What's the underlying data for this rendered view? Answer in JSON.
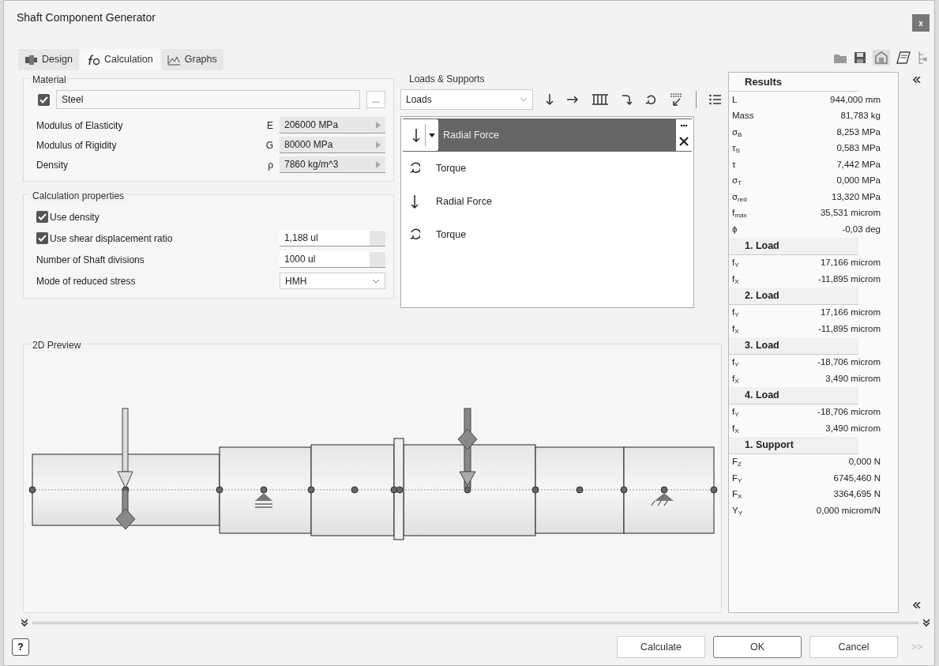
{
  "window": {
    "title": "Shaft Component Generator",
    "close": "x"
  },
  "tabs": [
    {
      "label": "Design",
      "selected": false,
      "kind": "design"
    },
    {
      "label": "Calculation",
      "selected": true,
      "kind": "calc"
    },
    {
      "label": "Graphs",
      "selected": false,
      "kind": "graph"
    }
  ],
  "material": {
    "title": "Material",
    "checked": true,
    "name": "Steel",
    "browse": "...",
    "properties": [
      {
        "label": "Modulus of Elasticity",
        "symbol": "E",
        "value": "206000 MPa"
      },
      {
        "label": "Modulus of Rigidity",
        "symbol": "G",
        "value": "80000 MPa"
      },
      {
        "label": "Density",
        "symbol": "ρ",
        "value": "7860 kg/m^3"
      }
    ]
  },
  "calculation_properties": {
    "title": "Calculation properties",
    "rows": [
      {
        "kind": "check",
        "label": "Use density",
        "checked": true
      },
      {
        "kind": "check-field",
        "label": "Use shear displacement ratio",
        "checked": true,
        "value": "1,188 ul"
      },
      {
        "kind": "field",
        "label": "Number of Shaft divisions",
        "value": "1000 ul"
      },
      {
        "kind": "select",
        "label": "Mode of reduced stress",
        "value": "HMH"
      }
    ]
  },
  "loads": {
    "title": "Loads & Supports",
    "filter": "Loads",
    "items": [
      {
        "kind": "radial",
        "label": "Radial Force",
        "selected": true
      },
      {
        "kind": "torque",
        "label": "Torque",
        "selected": false
      },
      {
        "kind": "radial",
        "label": "Radial Force",
        "selected": false
      },
      {
        "kind": "torque",
        "label": "Torque",
        "selected": false
      }
    ]
  },
  "preview": {
    "title": "2D Preview"
  },
  "results": {
    "title": "Results",
    "rows": [
      {
        "label": "L",
        "value": "944,000 mm"
      },
      {
        "label": "Mass",
        "value": "81,783 kg"
      },
      {
        "label": "σ$_{B}$",
        "value": "8,253 MPa"
      },
      {
        "label": "τ$_{S}$",
        "value": "0,583 MPa"
      },
      {
        "label": "τ",
        "value": "7,442 MPa"
      },
      {
        "label": "σ$_{T}$",
        "value": "0,000 MPa"
      },
      {
        "label": "σ$_{red}$",
        "value": "13,320 MPa"
      },
      {
        "label": "f$_{max}$",
        "value": "35,531 microm"
      },
      {
        "label": "ϕ",
        "value": "-0,03 deg"
      }
    ],
    "groups": [
      {
        "heading": "1. Load",
        "rows": [
          {
            "label": "f$_{Y}$",
            "value": "17,166 microm"
          },
          {
            "label": "f$_{X}$",
            "value": "-11,895 microm"
          }
        ]
      },
      {
        "heading": "2. Load",
        "rows": [
          {
            "label": "f$_{Y}$",
            "value": "17,166 microm"
          },
          {
            "label": "f$_{X}$",
            "value": "-11,895 microm"
          }
        ]
      },
      {
        "heading": "3. Load",
        "rows": [
          {
            "label": "f$_{Y}$",
            "value": "-18,706 microm"
          },
          {
            "label": "f$_{X}$",
            "value": "3,490 microm"
          }
        ]
      },
      {
        "heading": "4. Load",
        "rows": [
          {
            "label": "f$_{Y}$",
            "value": "-18,706 microm"
          },
          {
            "label": "f$_{X}$",
            "value": "3,490 microm"
          }
        ]
      },
      {
        "heading": "1. Support",
        "rows": [
          {
            "label": "F$_{Z}$",
            "value": "0,000 N"
          },
          {
            "label": "F$_{Y}$",
            "value": "6745,460 N"
          },
          {
            "label": "F$_{X}$",
            "value": "3364,695 N"
          },
          {
            "label": "Y$_{Y}$",
            "value": "0,000 microm/N"
          }
        ]
      }
    ]
  },
  "footer": {
    "help": "?",
    "buttons": [
      {
        "label": "Calculate",
        "disabled": false,
        "kind": "plain"
      },
      {
        "label": "OK",
        "disabled": false,
        "kind": "default"
      },
      {
        "label": "Cancel",
        "disabled": false,
        "kind": "plain"
      },
      {
        "label": ">>",
        "disabled": true,
        "kind": "flat"
      }
    ]
  }
}
